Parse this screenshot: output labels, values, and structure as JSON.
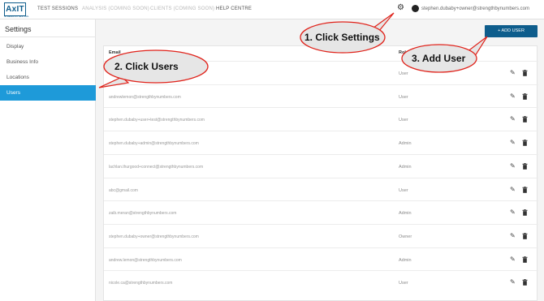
{
  "header": {
    "logo": "AxIT",
    "logo_sub": "STRENGTH TESTING",
    "nav": [
      {
        "label": "TEST SESSIONS"
      },
      {
        "label": "ANALYSIS (COMING SOON)"
      },
      {
        "label": "CLIENTS (COMING SOON)"
      },
      {
        "label": "HELP CENTRE"
      }
    ],
    "user_email": "stephen.dubaby+owner@strengthbynumbers.com"
  },
  "sidebar": {
    "title": "Settings",
    "items": [
      {
        "label": "Display"
      },
      {
        "label": "Business Info"
      },
      {
        "label": "Locations"
      },
      {
        "label": "Users"
      }
    ]
  },
  "toolbar": {
    "add_user_label": "+ ADD USER"
  },
  "table": {
    "columns": [
      "Email",
      "Role"
    ],
    "rows": [
      {
        "email": "",
        "role": "User"
      },
      {
        "email": "andrewlemon@strengthbynumbers.com",
        "role": "User"
      },
      {
        "email": "stephen.dubaby+user+test@strengthbynumbers.com",
        "role": "User"
      },
      {
        "email": "stephen.dubaby+admin@strengthbynumbers.com",
        "role": "Admin"
      },
      {
        "email": "lachlan.thurgood+connect@strengthbynumbers.com",
        "role": "Admin"
      },
      {
        "email": "abc@gmail.com",
        "role": "User"
      },
      {
        "email": "zaib.meran@strengthbynumbers.com",
        "role": "Admin"
      },
      {
        "email": "stephen.dubaby+owner@strengthbynumbers.com",
        "role": "Owner"
      },
      {
        "email": "andrew.lemon@strengthbynumbers.com",
        "role": "Admin"
      },
      {
        "email": "nicole.ca@strengthbynumbers.com",
        "role": "User"
      }
    ]
  },
  "callouts": [
    {
      "label": "1. Click Settings"
    },
    {
      "label": "2. Click Users"
    },
    {
      "label": "3. Add User"
    }
  ],
  "colors": {
    "accent": "#1e9ad9",
    "brand": "#0e5d8c",
    "callout_border": "#e0231b"
  },
  "icons": {
    "settings": "gear-icon",
    "account": "user-icon",
    "edit": "pencil-icon",
    "delete": "trash-icon"
  }
}
